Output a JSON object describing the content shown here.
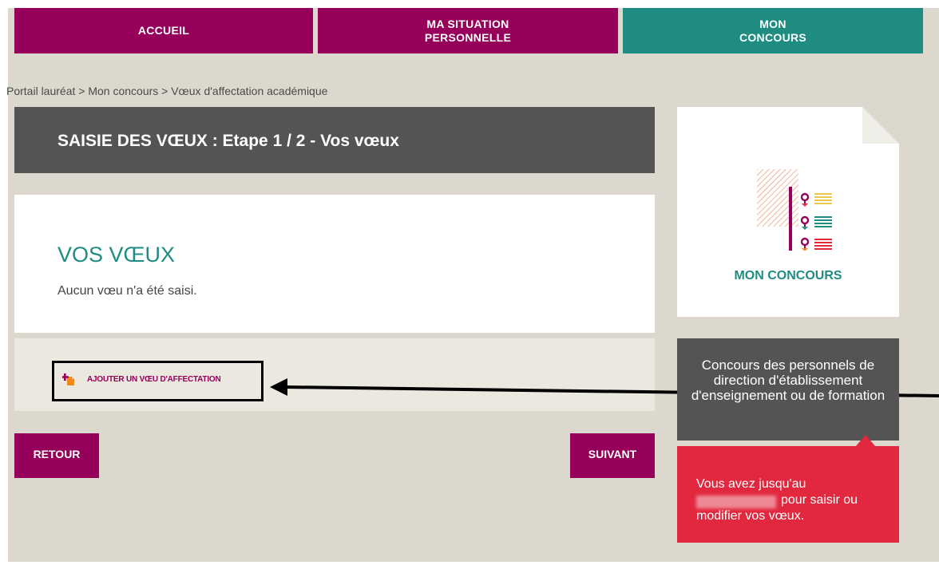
{
  "nav": {
    "home": "ACCUEIL",
    "situation": "MA SITUATION\nPERSONNELLE",
    "concours": "MON\nCONCOURS"
  },
  "breadcrumb": "Portail lauréat > Mon concours > Vœux d'affectation académique",
  "step_title": "SAISIE DES VŒUX : Etape 1 / 2 - Vos vœux",
  "voeux": {
    "title": "VOS VŒUX",
    "empty_text": "Aucun vœu n'a été saisi.",
    "add_label": "AJOUTER UN VŒU D'AFFECTATION"
  },
  "buttons": {
    "back": "RETOUR",
    "next": "SUIVANT"
  },
  "sidebar": {
    "card_title": "MON CONCOURS",
    "concours_name": "Concours des personnels de direction d'établissement d'enseignement ou de formation",
    "deadline_line1": "Vous avez jusqu'au",
    "deadline_line2": "pour saisir ou",
    "deadline_line3": "modifier vos vœux."
  },
  "colors": {
    "primary": "#96005a",
    "teal": "#1e8c80",
    "dark": "#545454",
    "alert": "#e2283e",
    "background": "#ddd8cd"
  },
  "icons": [
    "add-document-icon",
    "concours-list-icon"
  ]
}
